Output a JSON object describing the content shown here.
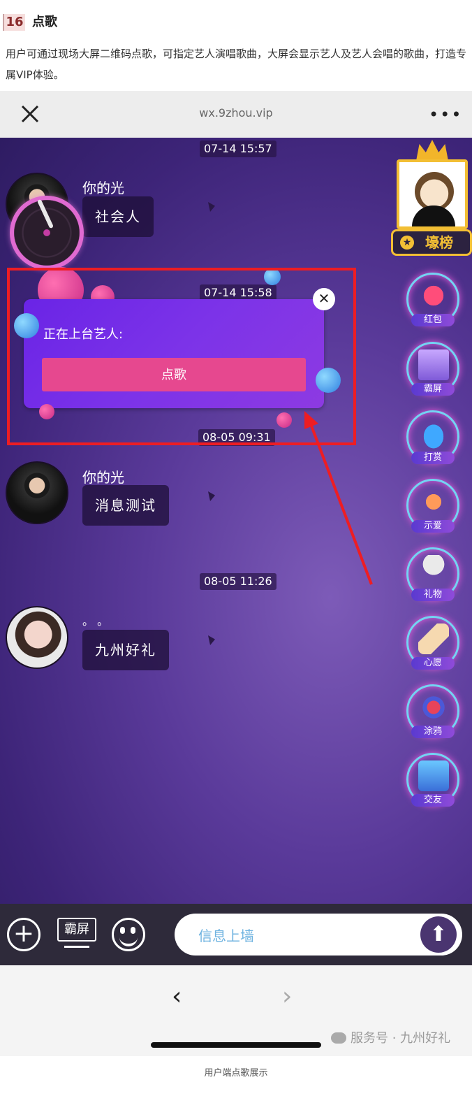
{
  "section": {
    "number": "16",
    "title": "点歌"
  },
  "intro": "用户可通过现场大屏二维码点歌，可指定艺人演唱歌曲，大屏会显示艺人及艺人会唱的歌曲，打造专属VIP体验。",
  "browser": {
    "url": "wx.9zhou.vip",
    "more": "•••"
  },
  "chat": {
    "timestamps": [
      "07-14 15:57",
      "07-14 15:58",
      "08-05 09:31",
      "08-05 11:26"
    ],
    "messages": [
      {
        "name": "你的光",
        "text": "社会人"
      },
      {
        "name": "你的光",
        "text": "消息测试"
      },
      {
        "name": "。 。",
        "text": "九州好礼"
      }
    ]
  },
  "leaderboard": {
    "label": "壕榜",
    "medal": "★"
  },
  "features": [
    "红包",
    "霸屏",
    "打赏",
    "示爱",
    "礼物",
    "心愿",
    "涂鸦",
    "交友"
  ],
  "popup": {
    "title": "正在上台艺人:",
    "button": "点歌",
    "close": "✕"
  },
  "input_bar": {
    "plus": "+",
    "ba_label": "霸屏",
    "placeholder": "信息上墙",
    "send": "⬆"
  },
  "nav": {
    "back": "‹",
    "forward": "›"
  },
  "watermark": "服务号 · 九州好礼",
  "caption": "用户端点歌展示",
  "colors": {
    "highlight": "#ee1d23",
    "popup_button": "#e6488f",
    "popup_bg": "#7c33e8"
  }
}
